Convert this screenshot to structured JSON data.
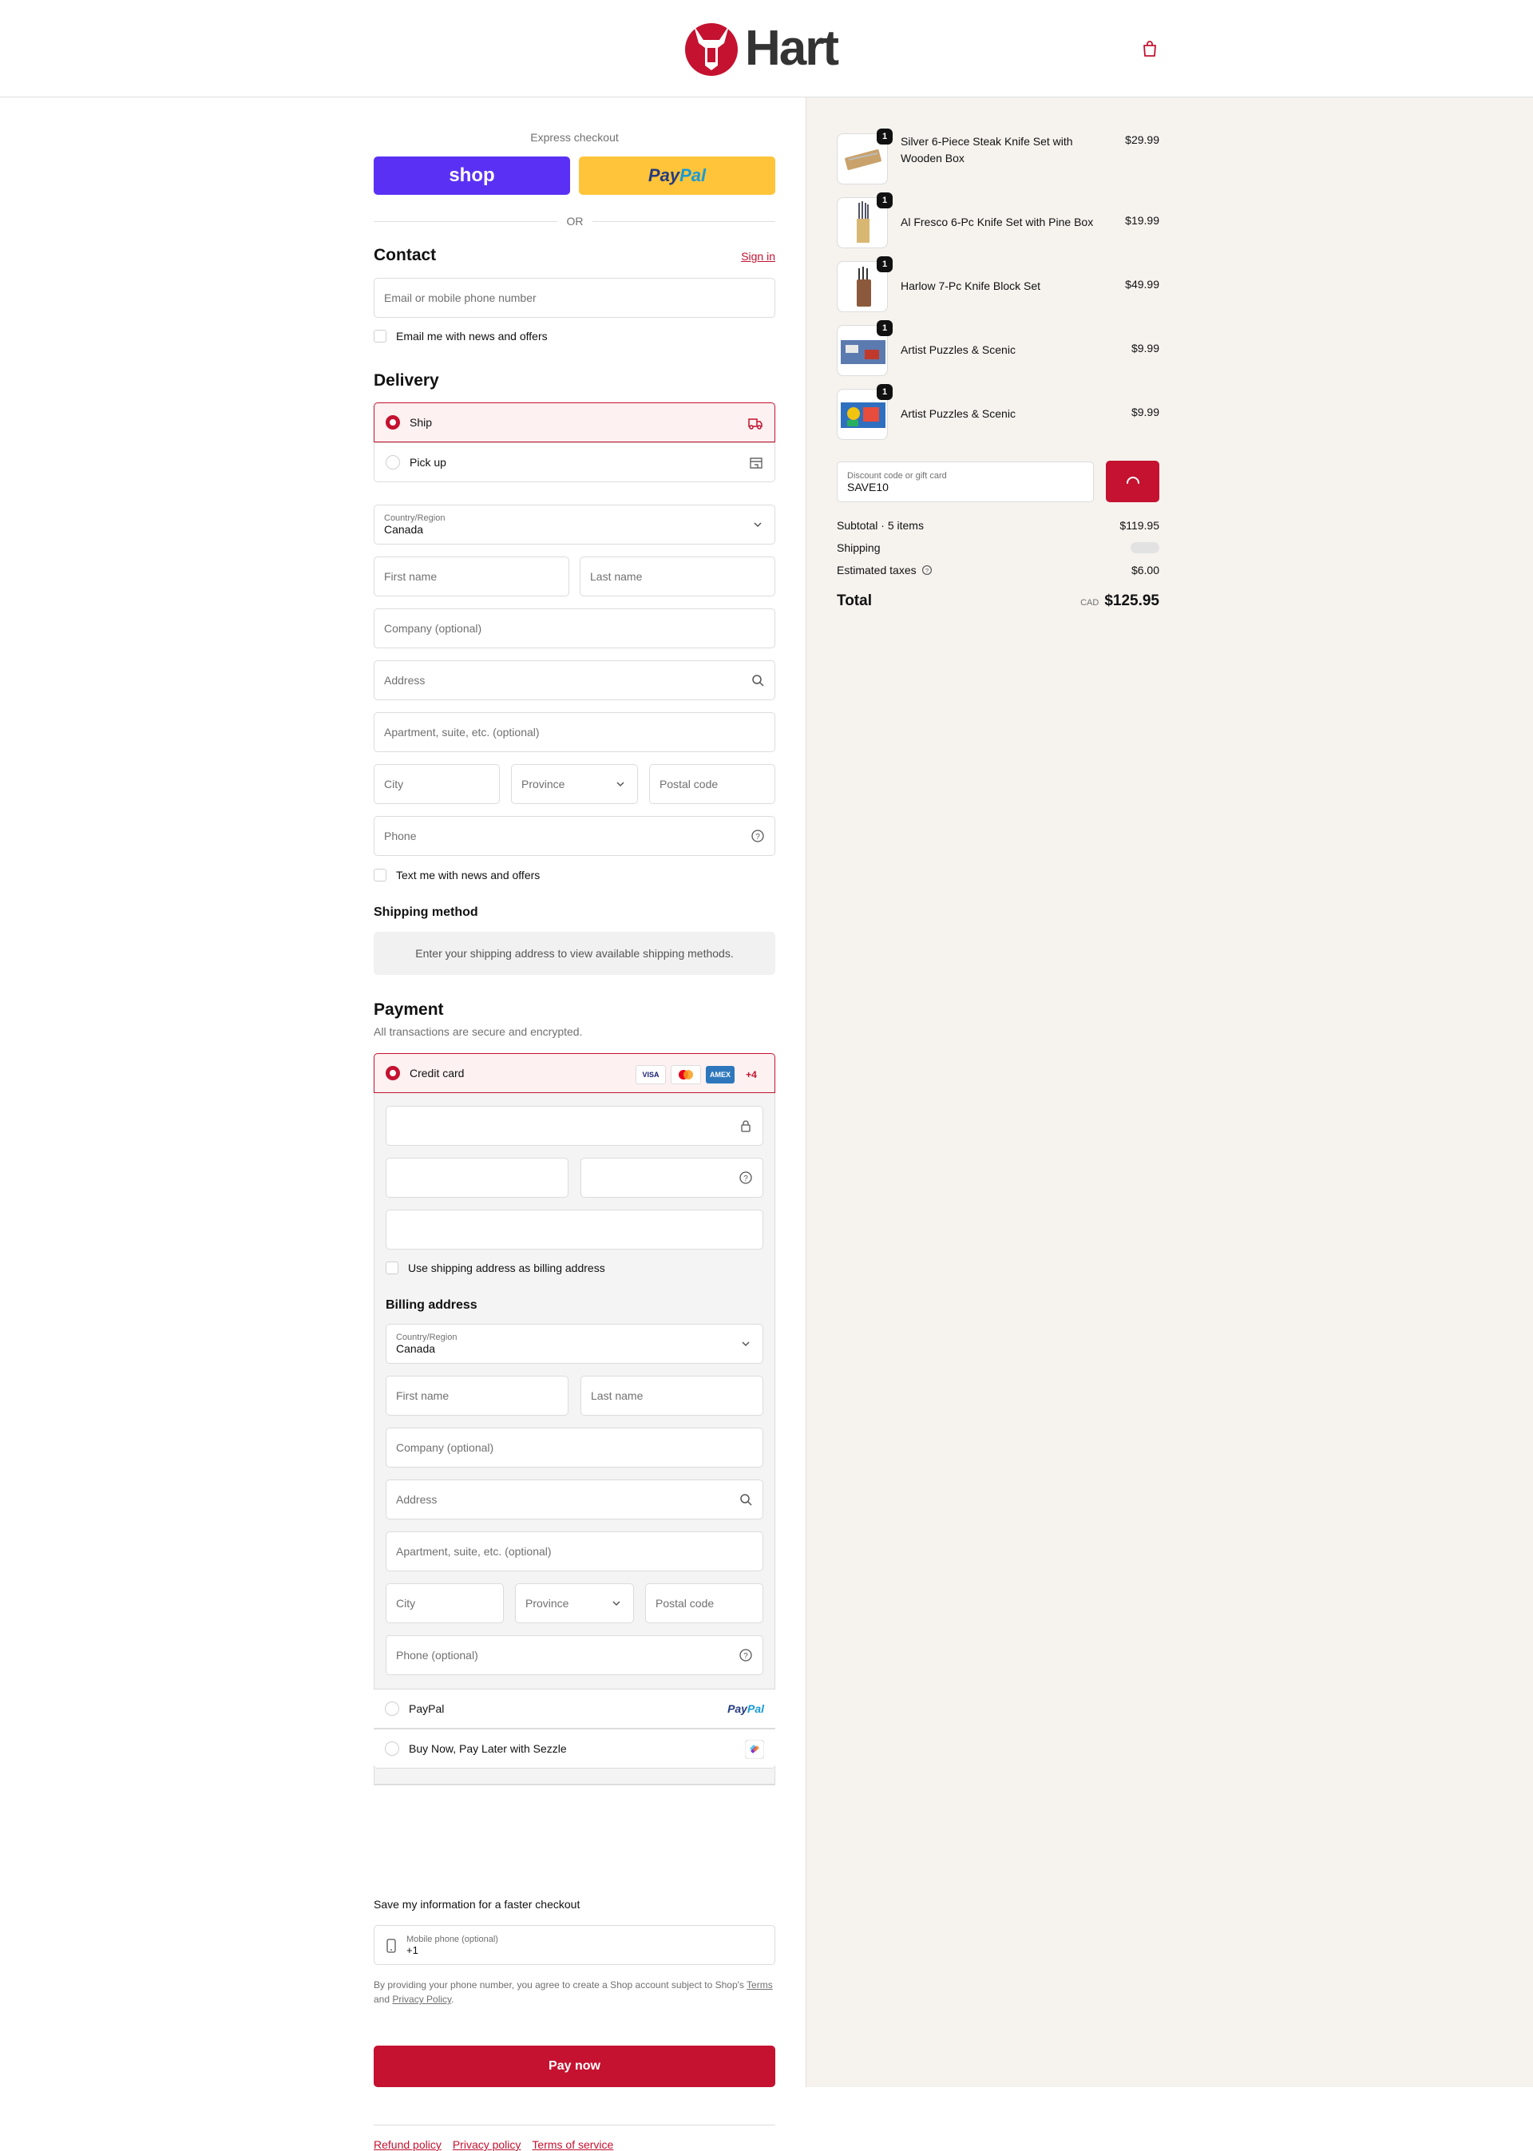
{
  "header": {
    "brand": "Hart",
    "cart_icon": "shopping-bag-icon"
  },
  "express": {
    "label": "Express checkout",
    "shop_label": "shop",
    "paypal_a": "Pay",
    "paypal_b": "Pal",
    "or": "OR"
  },
  "contact": {
    "title": "Contact",
    "sign_in": "Sign in",
    "email_placeholder": "Email or mobile phone number",
    "news_label": "Email me with news and offers"
  },
  "delivery": {
    "title": "Delivery",
    "options": [
      {
        "label": "Ship",
        "selected": true
      },
      {
        "label": "Pick up",
        "selected": false
      }
    ],
    "country_label": "Country/Region",
    "country_value": "Canada",
    "first_name": "First name",
    "last_name": "Last name",
    "company": "Company (optional)",
    "address": "Address",
    "apartment": "Apartment, suite, etc. (optional)",
    "city": "City",
    "province": "Province",
    "postal": "Postal code",
    "phone": "Phone",
    "text_news": "Text me with news and offers"
  },
  "shipping_method": {
    "title": "Shipping method",
    "notice": "Enter your shipping address to view available shipping methods."
  },
  "payment": {
    "title": "Payment",
    "subtitle": "All transactions are secure and encrypted.",
    "credit_card": "Credit card",
    "cards": [
      "VISA",
      "MC",
      "AMEX"
    ],
    "more": "+4",
    "use_shipping": "Use shipping address as billing address",
    "billing_title": "Billing address",
    "billing": {
      "country_label": "Country/Region",
      "country_value": "Canada",
      "first_name": "First name",
      "last_name": "Last name",
      "company": "Company (optional)",
      "address": "Address",
      "apartment": "Apartment, suite, etc. (optional)",
      "city": "City",
      "province": "Province",
      "postal": "Postal code",
      "phone": "Phone (optional)"
    },
    "paypal": "PayPal",
    "paypal_logo_a": "Pay",
    "paypal_logo_b": "Pal",
    "sezzle": "Buy Now, Pay Later with Sezzle"
  },
  "save": {
    "title": "Save my information for a faster checkout",
    "mobile_label": "Mobile phone (optional)",
    "mobile_value": "+1",
    "legal_1": "By providing your phone number, you agree to create a Shop account subject to Shop's",
    "terms": "Terms",
    "legal_and": "and",
    "privacy": "Privacy Policy",
    "legal_end": "."
  },
  "pay_now": "Pay now",
  "footer": {
    "refund": "Refund policy",
    "privacy": "Privacy policy",
    "terms": "Terms of service"
  },
  "order": {
    "items": [
      {
        "name": "Silver 6-Piece Steak Knife Set with Wooden Box",
        "price": "$29.99",
        "qty": "1"
      },
      {
        "name": "Al Fresco 6-Pc Knife Set with Pine Box",
        "price": "$19.99",
        "qty": "1"
      },
      {
        "name": "Harlow 7-Pc Knife Block Set",
        "price": "$49.99",
        "qty": "1"
      },
      {
        "name": "Artist Puzzles & Scenic",
        "price": "$9.99",
        "qty": "1"
      },
      {
        "name": "Artist Puzzles & Scenic",
        "price": "$9.99",
        "qty": "1"
      }
    ],
    "discount_label": "Discount code or gift card",
    "discount_value": "SAVE10",
    "subtotal_label": "Subtotal · 5 items",
    "subtotal": "$119.95",
    "shipping_label": "Shipping",
    "taxes_label": "Estimated taxes",
    "taxes": "$6.00",
    "total_label": "Total",
    "currency": "CAD",
    "total": "$125.95"
  },
  "colors": {
    "accent": "#c41230",
    "shop": "#5a31f4",
    "paypal": "#ffc439",
    "sidebar": "#f6f3ef"
  }
}
